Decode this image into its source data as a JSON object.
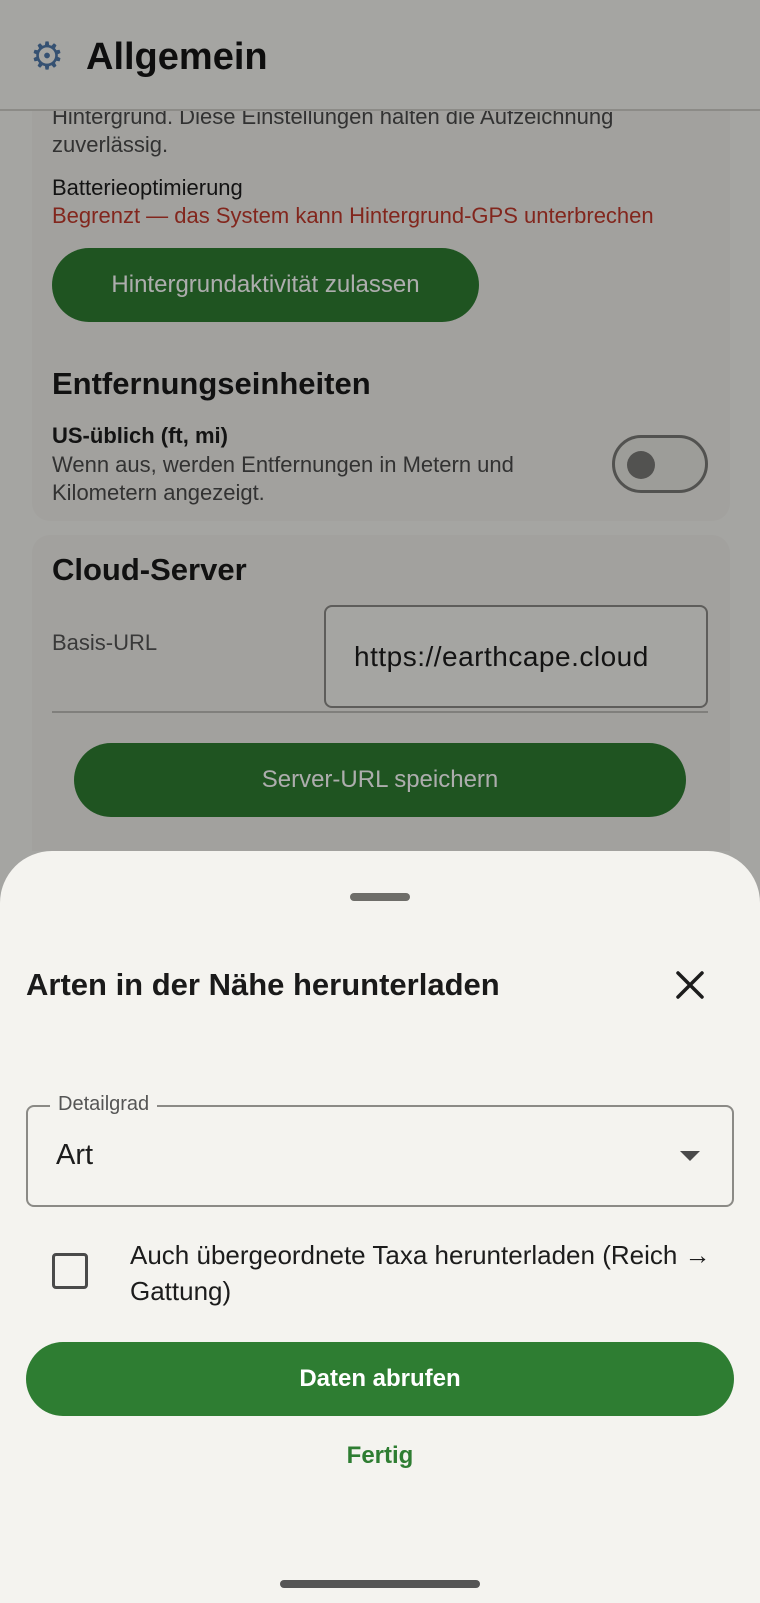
{
  "app_bar": {
    "title": "Allgemein",
    "icon": "gear-icon"
  },
  "background_settings": {
    "background_activity": {
      "description_cut": "Hintergrund. Diese Einstellungen halten die Aufzeichnung zuverlässig.",
      "battery_label": "Batterieoptimierung",
      "battery_status": "Begrenzt — das System kann Hintergrund-GPS unterbrechen",
      "button_label": "Hintergrundaktivität zulassen"
    },
    "distance_units": {
      "heading": "Entfernungseinheiten",
      "toggle_label": "US-üblich (ft, mi)",
      "toggle_description": "Wenn aus, werden Entfernungen in Metern und Kilometern angezeigt.",
      "toggle_on": false
    },
    "cloud_server": {
      "heading": "Cloud-Server",
      "url_label": "Basis-URL",
      "url_value": "https://earthcape.cloud",
      "save_button_label": "Server-URL speichern"
    }
  },
  "bottom_sheet": {
    "title": "Arten in der Nähe herunterladen",
    "detail_select": {
      "label": "Detailgrad",
      "selected": "Art"
    },
    "checkbox": {
      "label": "Auch übergeordnete Taxa herunterladen (Reich → Gattung)",
      "checked": false
    },
    "primary_button_label": "Daten abrufen",
    "done_button_label": "Fertig"
  },
  "colors": {
    "accent_green": "#2e7d32",
    "warning_red": "#c0392b",
    "surface": "#f4f3ef"
  }
}
